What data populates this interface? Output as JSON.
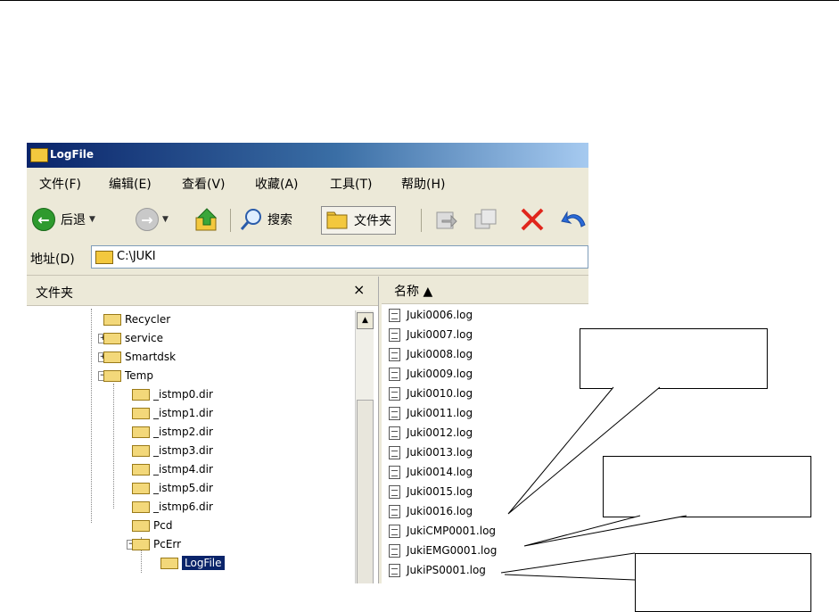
{
  "window": {
    "title": "LogFile",
    "icon": "folder-icon"
  },
  "menu": [
    "文件(F)",
    "编辑(E)",
    "查看(V)",
    "收藏(A)",
    "工具(T)",
    "帮助(H)"
  ],
  "toolbar": {
    "back": "后退",
    "search": "搜索",
    "folders": "文件夹"
  },
  "address": {
    "label": "地址(D)",
    "value": "C:\\JUKI"
  },
  "folder_pane": {
    "title": "文件夹",
    "close": "×",
    "items": [
      "Recycler",
      "service",
      "Smartdsk",
      "Temp",
      "_istmp0.dir",
      "_istmp1.dir",
      "_istmp2.dir",
      "_istmp3.dir",
      "_istmp4.dir",
      "_istmp5.dir",
      "_istmp6.dir",
      "Pcd",
      "PcErr",
      "LogFile"
    ]
  },
  "file_pane": {
    "header": "名称 ▲",
    "files": [
      "Juki0006.log",
      "Juki0007.log",
      "Juki0008.log",
      "Juki0009.log",
      "Juki0010.log",
      "Juki0011.log",
      "Juki0012.log",
      "Juki0013.log",
      "Juki0014.log",
      "Juki0015.log",
      "Juki0016.log",
      "JukiCMP0001.log",
      "JukiEMG0001.log",
      "JukiPS0001.log"
    ]
  },
  "icons": {
    "back": "back-arrow-icon",
    "forward": "forward-arrow-icon",
    "up": "up-folder-icon",
    "search": "search-icon",
    "folders": "folders-icon",
    "move": "move-to-icon",
    "copy": "copy-to-icon",
    "delete": "delete-icon",
    "undo": "undo-icon"
  }
}
